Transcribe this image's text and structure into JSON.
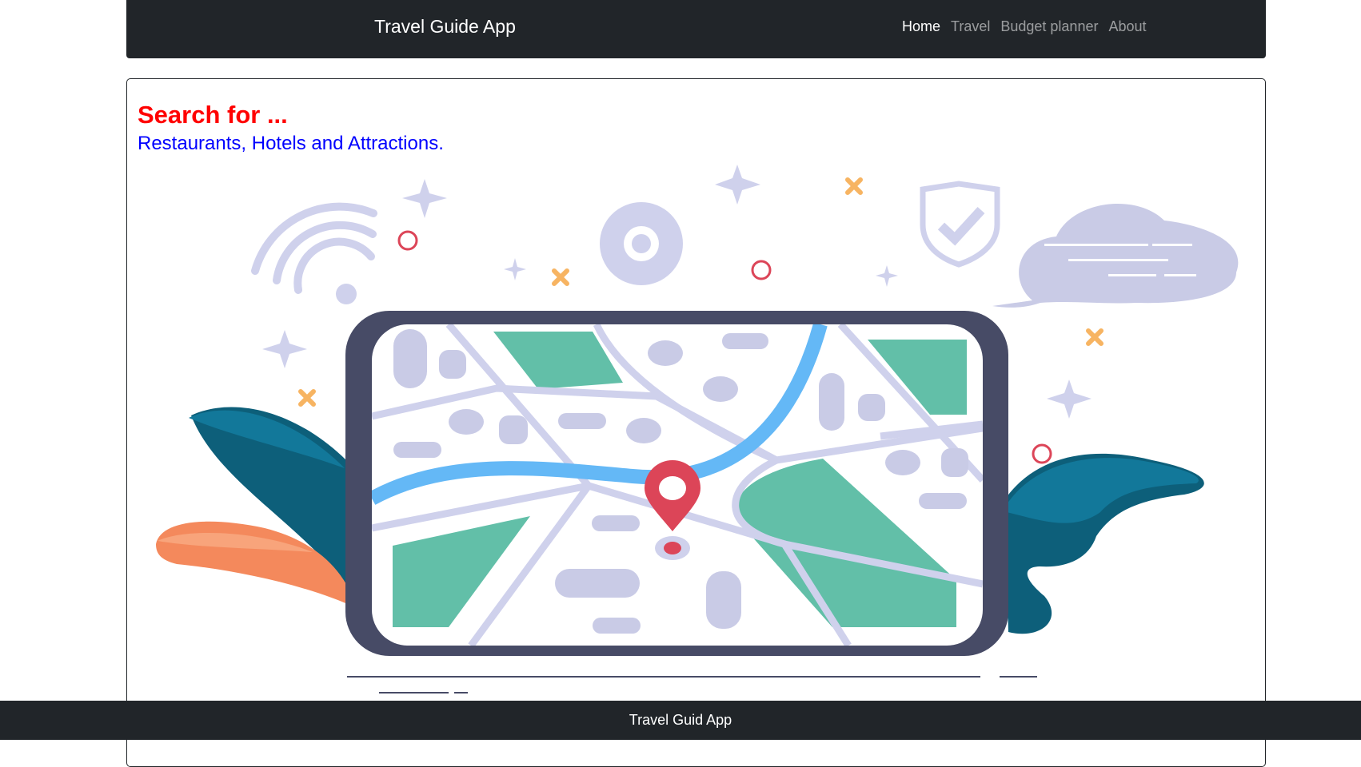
{
  "navbar": {
    "brand": "Travel Guide App",
    "links": [
      {
        "label": "Home",
        "active": true
      },
      {
        "label": "Travel",
        "active": false
      },
      {
        "label": "Budget planner",
        "active": false
      },
      {
        "label": "About",
        "active": false
      }
    ]
  },
  "main": {
    "heading": "Search for ...",
    "subheading": "Restaurants, Hotels and Attractions.",
    "illustration": {
      "icons": [
        "wifi-icon",
        "gear-icon",
        "shield-check-icon",
        "cloud-icon",
        "map-pin-icon",
        "sparkle-icon"
      ]
    }
  },
  "footer": {
    "text": "Travel Guid App"
  },
  "colors": {
    "navbar_bg": "#212529",
    "heading": "#ff0000",
    "subheading": "#0000ff",
    "map_green": "#62bfa8",
    "river": "#64b8f6",
    "pin": "#dc4558",
    "device_frame": "#474b66",
    "deco_lavender": "#c9cbe6"
  }
}
